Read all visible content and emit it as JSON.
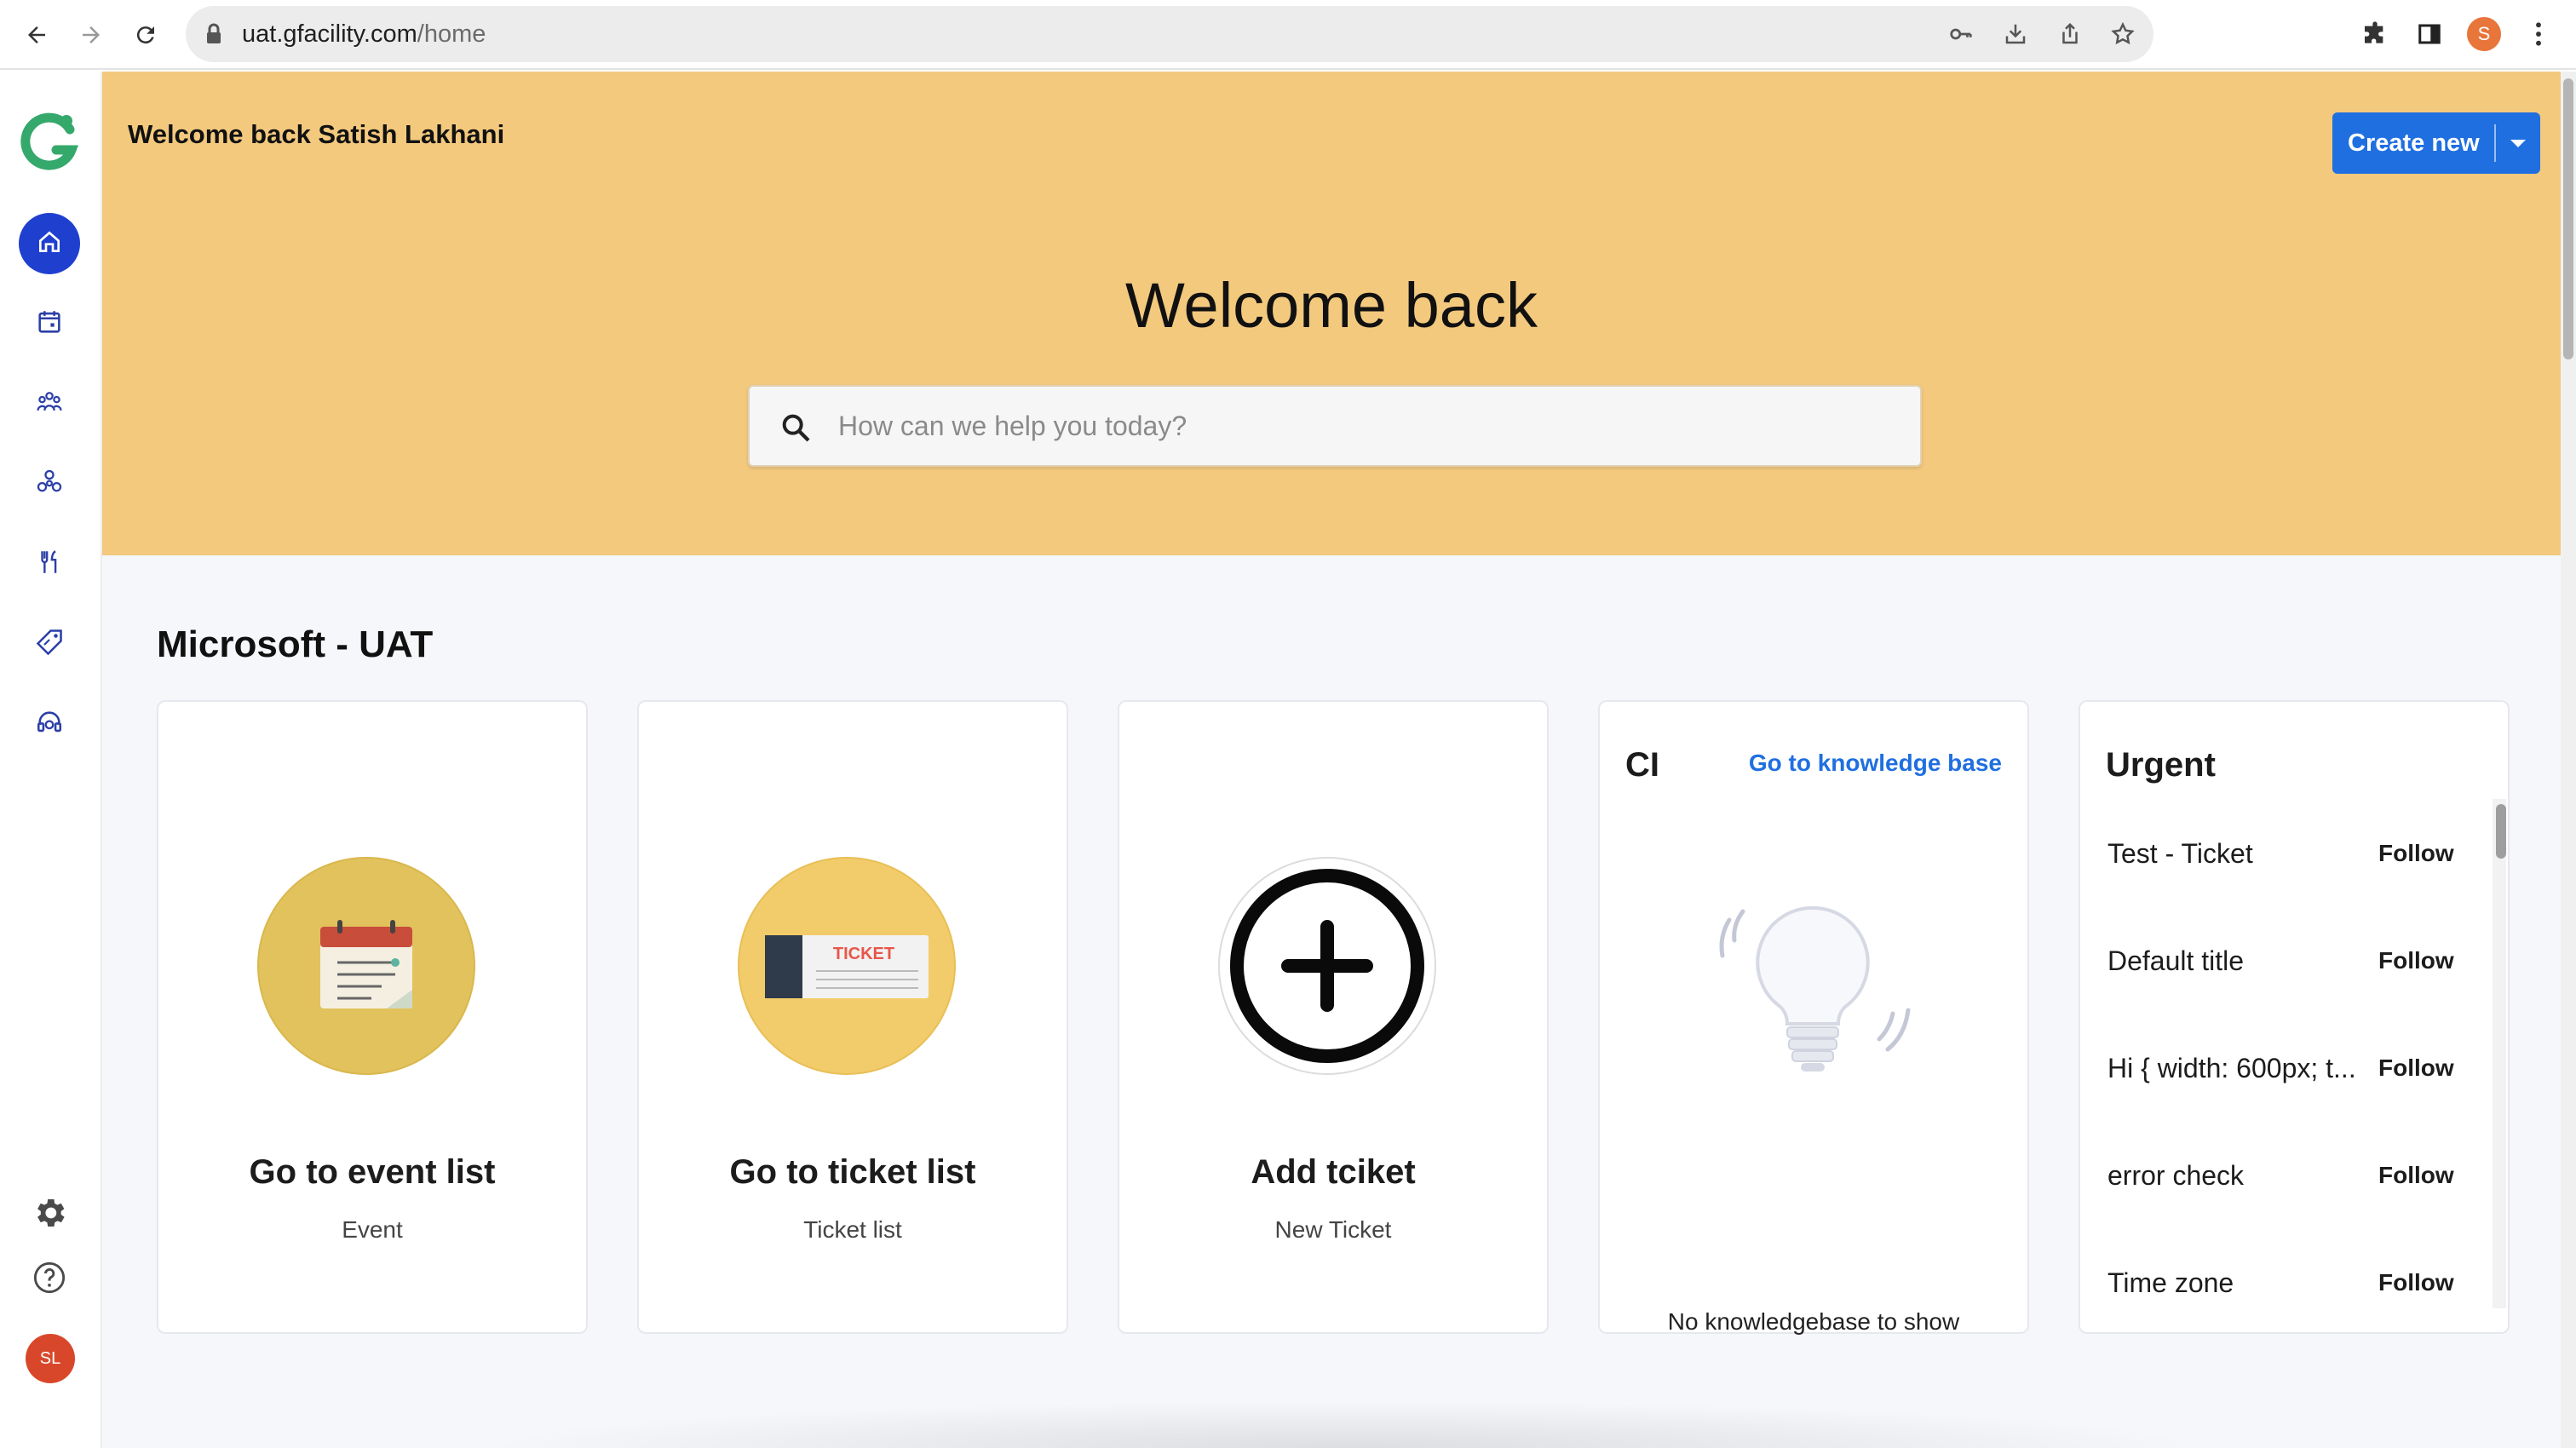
{
  "browser": {
    "url_host": "uat.gfacility.com",
    "url_path": "/home",
    "profile_initial": "S"
  },
  "sidebar": {
    "items": [
      {
        "name": "home",
        "active": true
      },
      {
        "name": "calendar",
        "active": false
      },
      {
        "name": "team",
        "active": false
      },
      {
        "name": "network",
        "active": false
      },
      {
        "name": "tools",
        "active": false
      },
      {
        "name": "tags",
        "active": false
      },
      {
        "name": "support",
        "active": false
      }
    ],
    "avatar_initials": "SL"
  },
  "header": {
    "greeting": "Welcome back Satish Lakhani",
    "create_label": "Create new"
  },
  "hero": {
    "title": "Welcome back",
    "search_placeholder": "How can we help you today?",
    "search_value": ""
  },
  "section": {
    "title": "Microsoft - UAT"
  },
  "cards": [
    {
      "title": "Go to event list",
      "subtitle": "Event",
      "icon": "calendar-icon"
    },
    {
      "title": "Go to ticket list",
      "subtitle": "Ticket list",
      "icon": "ticket-icon",
      "ticket_text": "TICKET"
    },
    {
      "title": "Add tciket",
      "subtitle": "New Ticket",
      "icon": "plus-circle-icon"
    }
  ],
  "knowledge": {
    "title": "CI",
    "link": "Go to knowledge base",
    "empty": "No knowledgebase to show"
  },
  "urgent": {
    "title": "Urgent",
    "follow_label": "Follow",
    "items": [
      "Test - Ticket",
      "Default title",
      "Hi { width: 600px; t...",
      "error check",
      "Time zone"
    ]
  },
  "colors": {
    "hero_bg": "#f3c97e",
    "accent": "#1f6fe0",
    "active_nav": "#1f3fcf",
    "avatar": "#d9472b"
  }
}
